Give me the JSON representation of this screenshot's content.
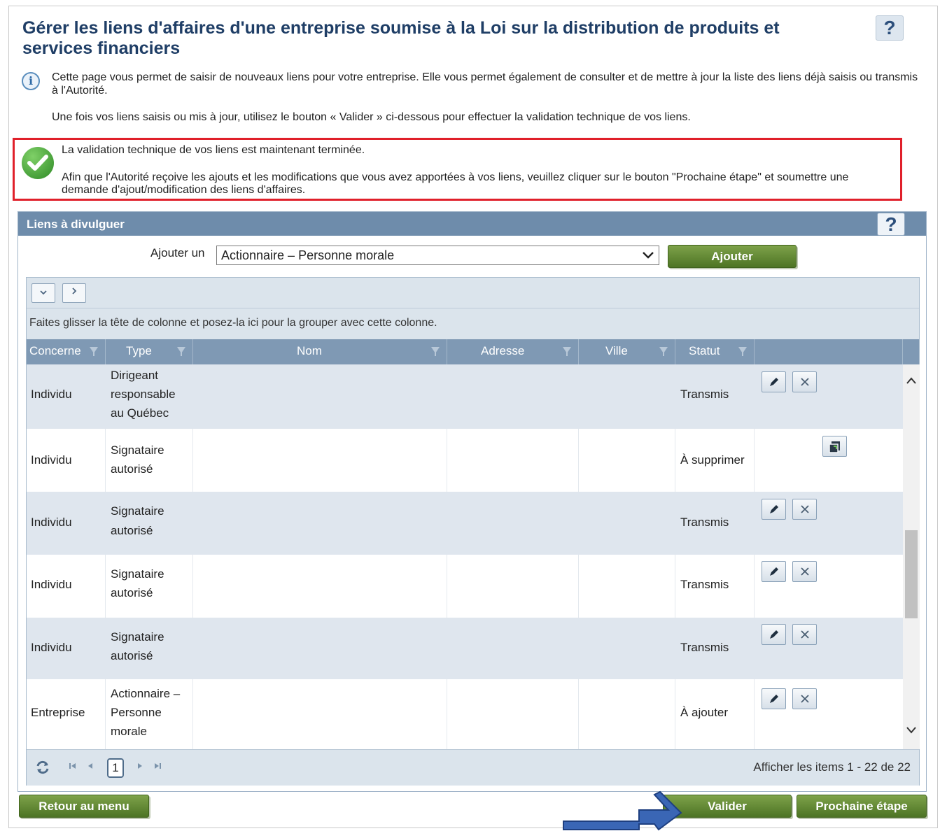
{
  "page": {
    "title": "Gérer les liens d'affaires d'une entreprise soumise à la Loi sur la distribution de produits et services financiers",
    "help_label": "?"
  },
  "info": {
    "text1": "Cette page vous permet de saisir de nouveaux liens pour votre entreprise. Elle vous permet également de consulter et de mettre à jour la liste des liens déjà saisis ou transmis à l'Autorité.",
    "text2": "Une fois vos liens saisis ou mis à jour, utilisez le bouton « Valider » ci-dessous pour effectuer la validation technique de vos liens."
  },
  "success": {
    "line1": "La validation technique de vos liens est maintenant terminée.",
    "line2": "Afin que l'Autorité reçoive les ajouts et les modifications que vous avez apportées à vos liens, veuillez cliquer sur le bouton \"Prochaine étape\" et soumettre une demande d'ajout/modification des liens d'affaires."
  },
  "panel": {
    "title": "Liens à divulguer",
    "help_label": "?",
    "add_label": "Ajouter un",
    "add_select_value": "Actionnaire – Personne morale",
    "add_button": "Ajouter"
  },
  "grid": {
    "group_hint": "Faites glisser la tête de colonne et posez-la ici pour la grouper avec cette colonne.",
    "columns": [
      "Concerne",
      "Type",
      "Nom",
      "Adresse",
      "Ville",
      "Statut"
    ],
    "rows": [
      {
        "concerne": "Individu",
        "type_lines": [
          "Dirigeant",
          "responsable",
          "au Québec"
        ],
        "statut": "Transmis",
        "actions": "edit-delete"
      },
      {
        "concerne": "Individu",
        "type_lines": [
          "Signataire",
          "autorisé"
        ],
        "statut": "À supprimer",
        "actions": "restore"
      },
      {
        "concerne": "Individu",
        "type_lines": [
          "Signataire",
          "autorisé"
        ],
        "statut": "Transmis",
        "actions": "edit-delete"
      },
      {
        "concerne": "Individu",
        "type_lines": [
          "Signataire",
          "autorisé"
        ],
        "statut": "Transmis",
        "actions": "edit-delete"
      },
      {
        "concerne": "Individu",
        "type_lines": [
          "Signataire",
          "autorisé"
        ],
        "statut": "Transmis",
        "actions": "edit-delete"
      },
      {
        "concerne": "Entreprise",
        "type_lines": [
          "Actionnaire –",
          "Personne",
          "morale"
        ],
        "statut": "À ajouter",
        "actions": "edit-delete"
      }
    ],
    "pager": {
      "current_page": "1",
      "info": "Afficher les items 1 - 22 de 22"
    }
  },
  "footer": {
    "back_button": "Retour au menu",
    "validate_button": "Valider",
    "next_button": "Prochaine étape"
  },
  "colors": {
    "title": "#1f3e66",
    "panel_header": "#6e8cab",
    "grid_header": "#7f99b4",
    "row_alt": "#dfe6ee",
    "button_green": "#5f8632",
    "alert_border": "#e0202a",
    "annotation_arrow": "#3a66b5"
  }
}
